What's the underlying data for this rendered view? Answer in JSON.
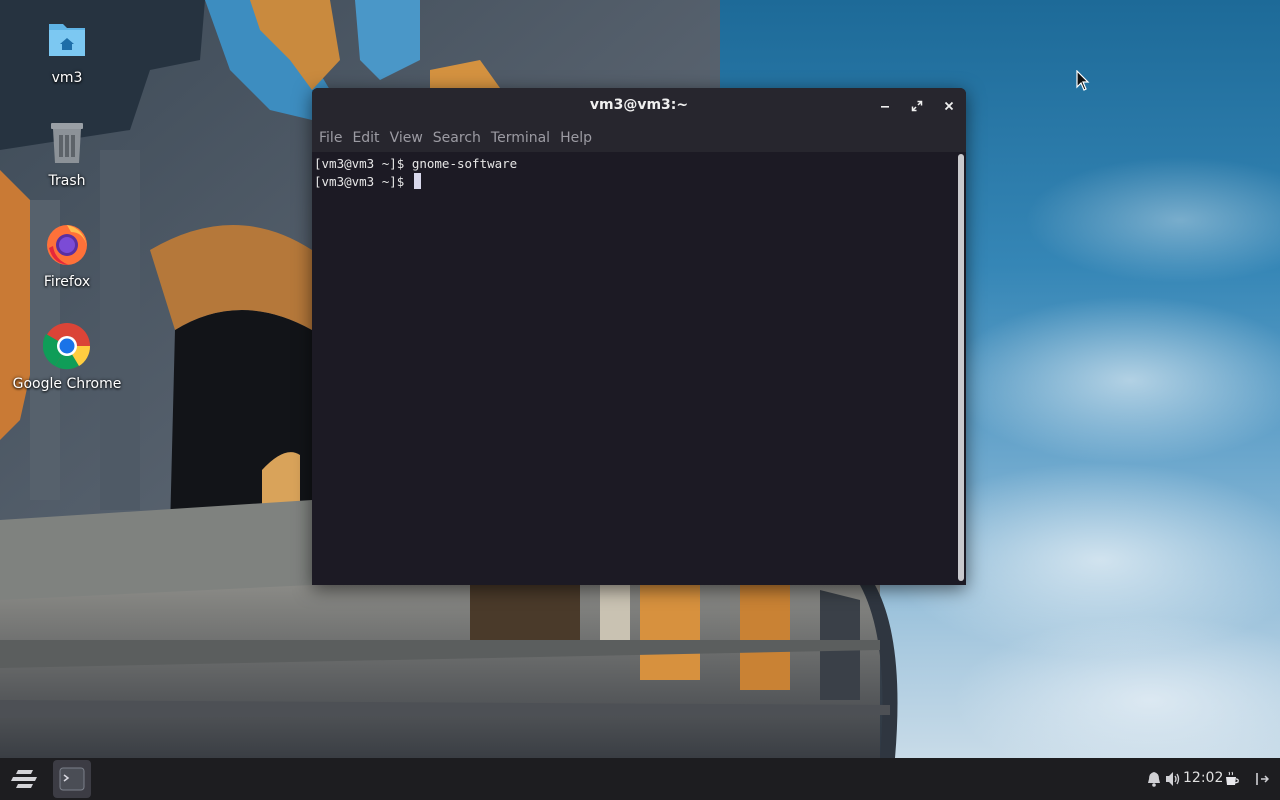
{
  "desktop": {
    "icons": [
      {
        "label": "vm3",
        "icon": "home-folder-icon"
      },
      {
        "label": "Trash",
        "icon": "trash-icon"
      },
      {
        "label": "Firefox",
        "icon": "firefox-icon"
      },
      {
        "label": "Google Chrome",
        "icon": "chrome-icon"
      }
    ]
  },
  "terminal": {
    "title": "vm3@vm3:~",
    "menu": [
      "File",
      "Edit",
      "View",
      "Search",
      "Terminal",
      "Help"
    ],
    "lines": [
      "[vm3@vm3 ~]$ gnome-software",
      "[vm3@vm3 ~]$ "
    ],
    "buttons": {
      "minimize": "minimize-icon",
      "maximize": "maximize-icon",
      "close": "close-icon"
    }
  },
  "taskbar": {
    "clock": "12:02",
    "launcher_icon": "zorin-menu-icon",
    "active_app_icon": "terminal-icon",
    "tray_icons": [
      "bell-icon",
      "volume-icon",
      "coffee-icon",
      "logout-icon"
    ]
  },
  "colors": {
    "terminal_bg": "#1c1a24",
    "titlebar_bg": "#27262e",
    "taskbar_bg": "#1d1d20",
    "menu_text": "#9c9ba3"
  }
}
